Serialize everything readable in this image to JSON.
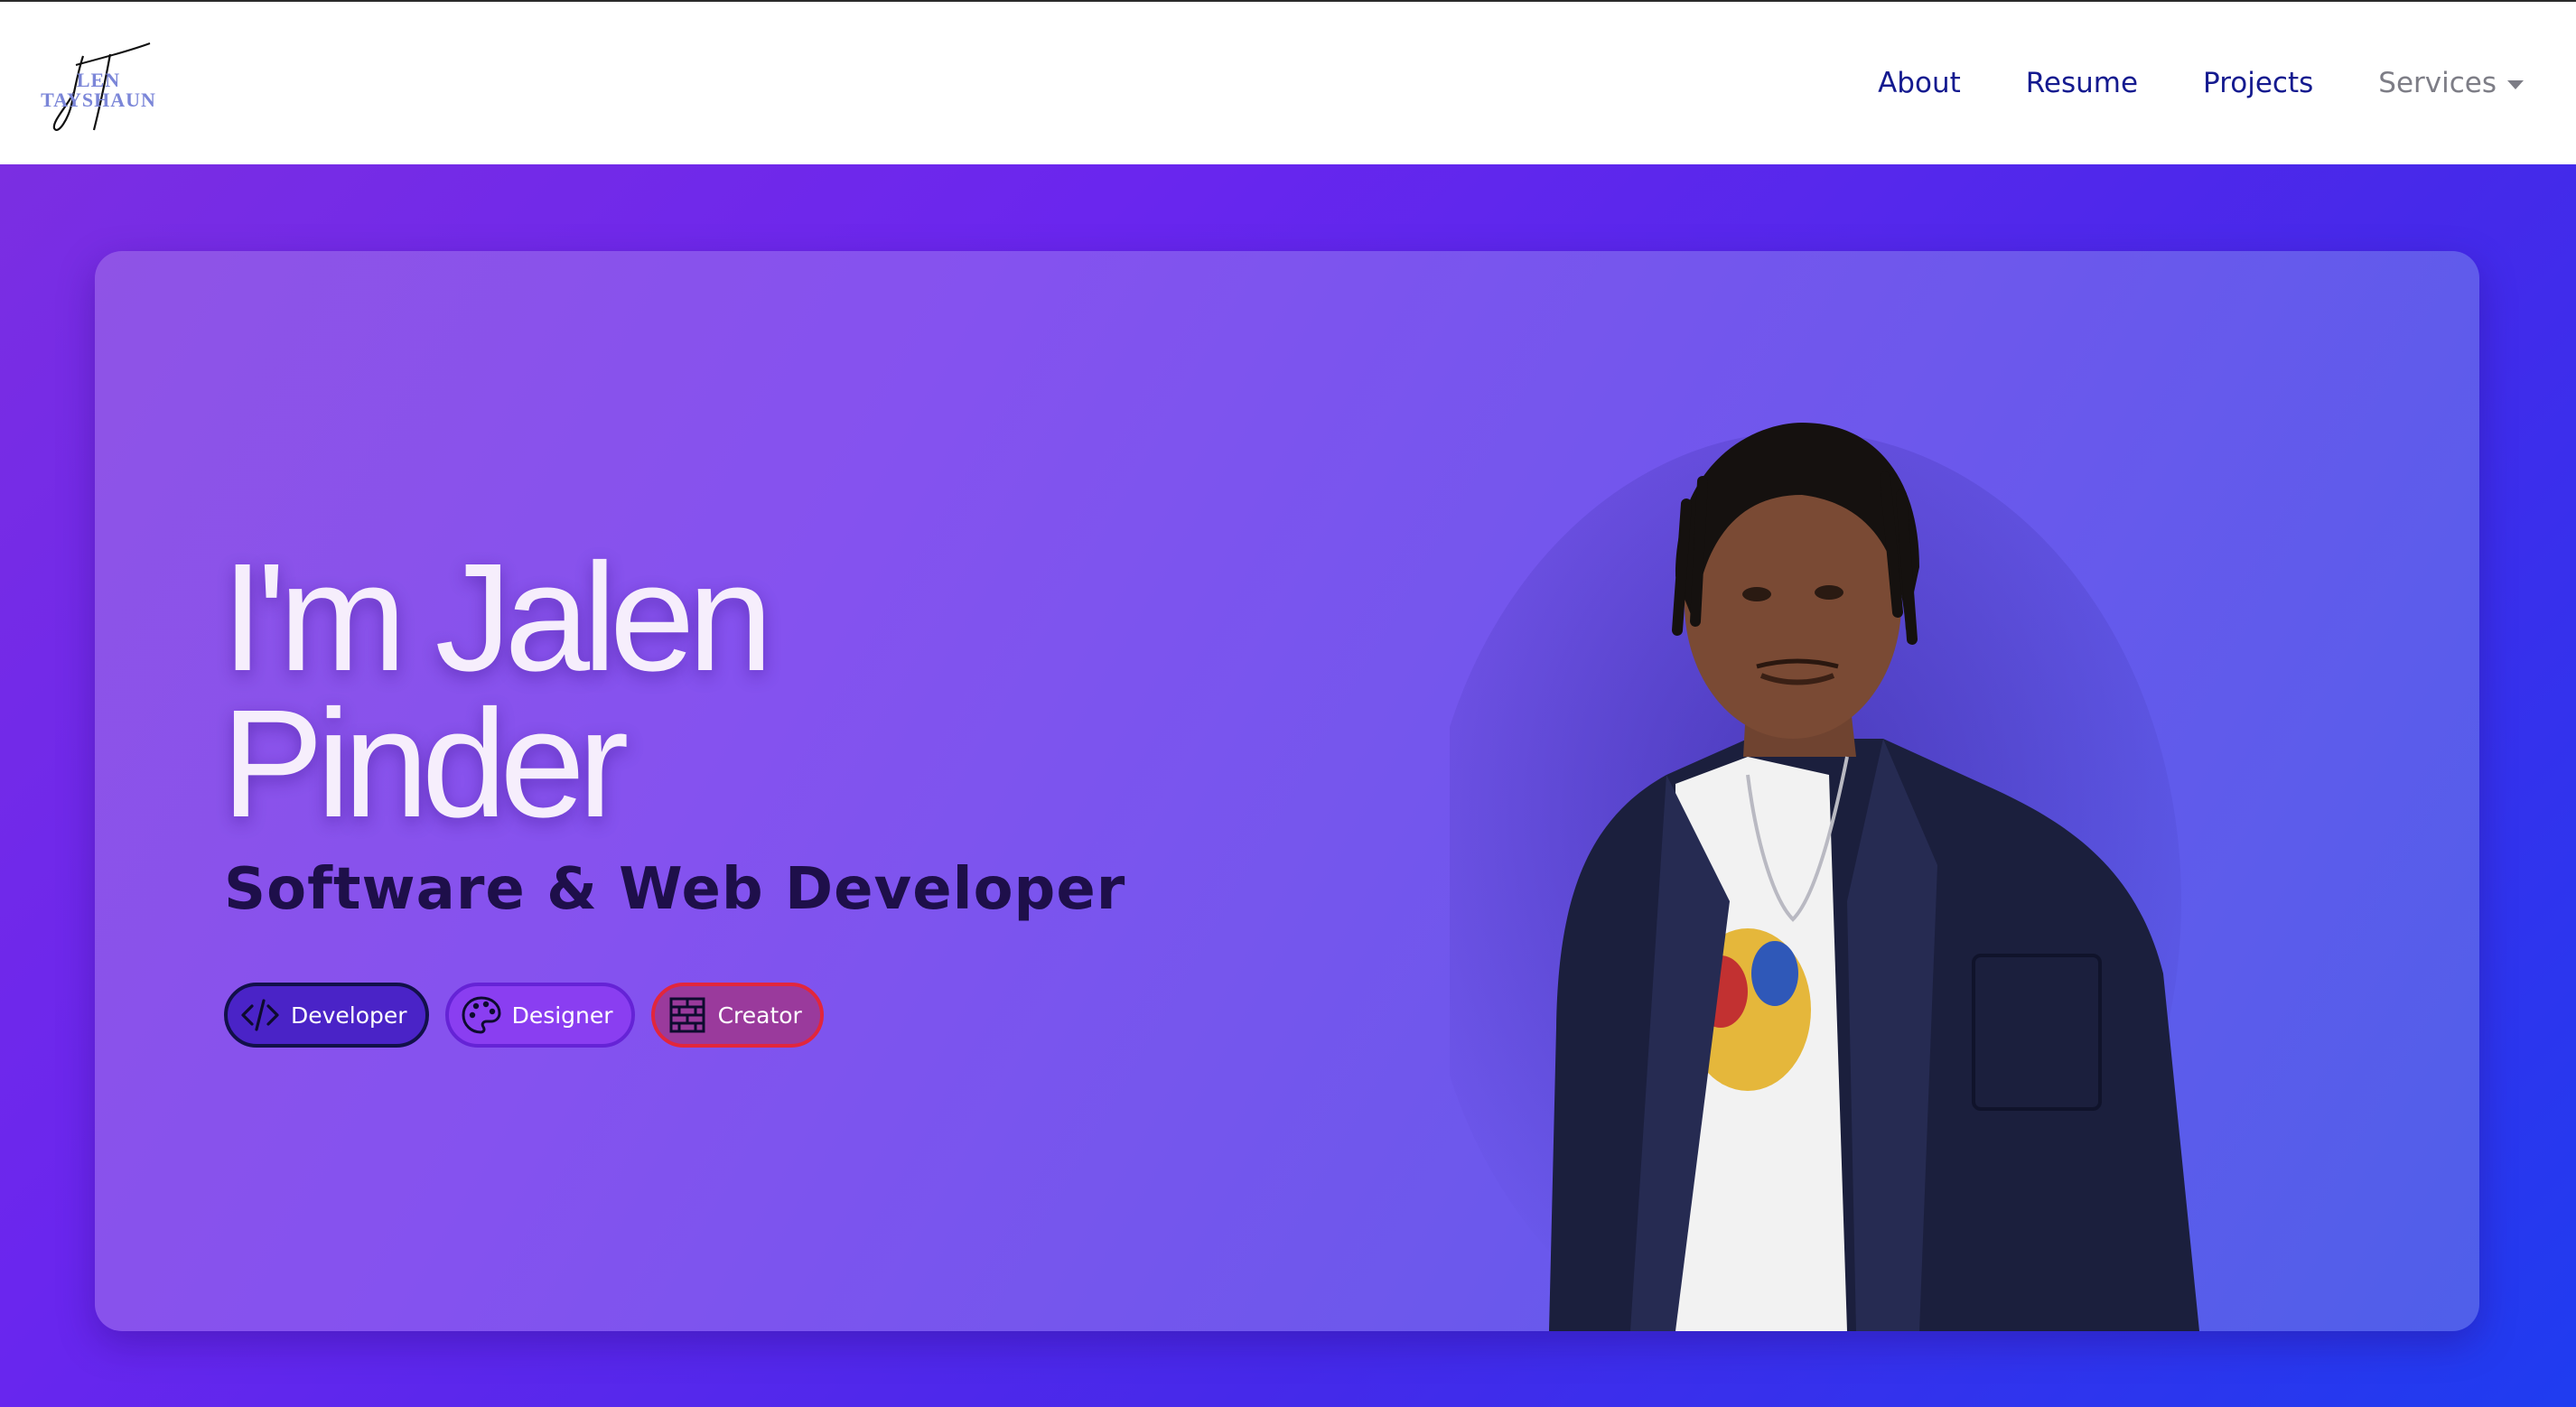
{
  "logo": {
    "script_text": "JT",
    "letters": "LEN\nTAYSHAUN"
  },
  "nav": {
    "links": [
      {
        "label": "About"
      },
      {
        "label": "Resume"
      },
      {
        "label": "Projects"
      }
    ],
    "dropdown": {
      "label": "Services"
    }
  },
  "hero": {
    "headline": "I'm Jalen\nPinder",
    "subtitle": "Software & Web Developer",
    "tags": [
      {
        "label": "Developer",
        "icon": "code-icon"
      },
      {
        "label": "Designer",
        "icon": "palette-icon"
      },
      {
        "label": "Creator",
        "icon": "brick-wall-icon"
      }
    ]
  },
  "colors": {
    "nav_link": "#141a8f",
    "nav_muted": "#7d7d86",
    "hero_gradient_start": "#7b2ee2",
    "hero_gradient_end": "#1f3cf0",
    "tag_developer": "#4a23c7",
    "tag_designer": "#8a3ef1",
    "tag_creator_border": "#e2263c"
  }
}
